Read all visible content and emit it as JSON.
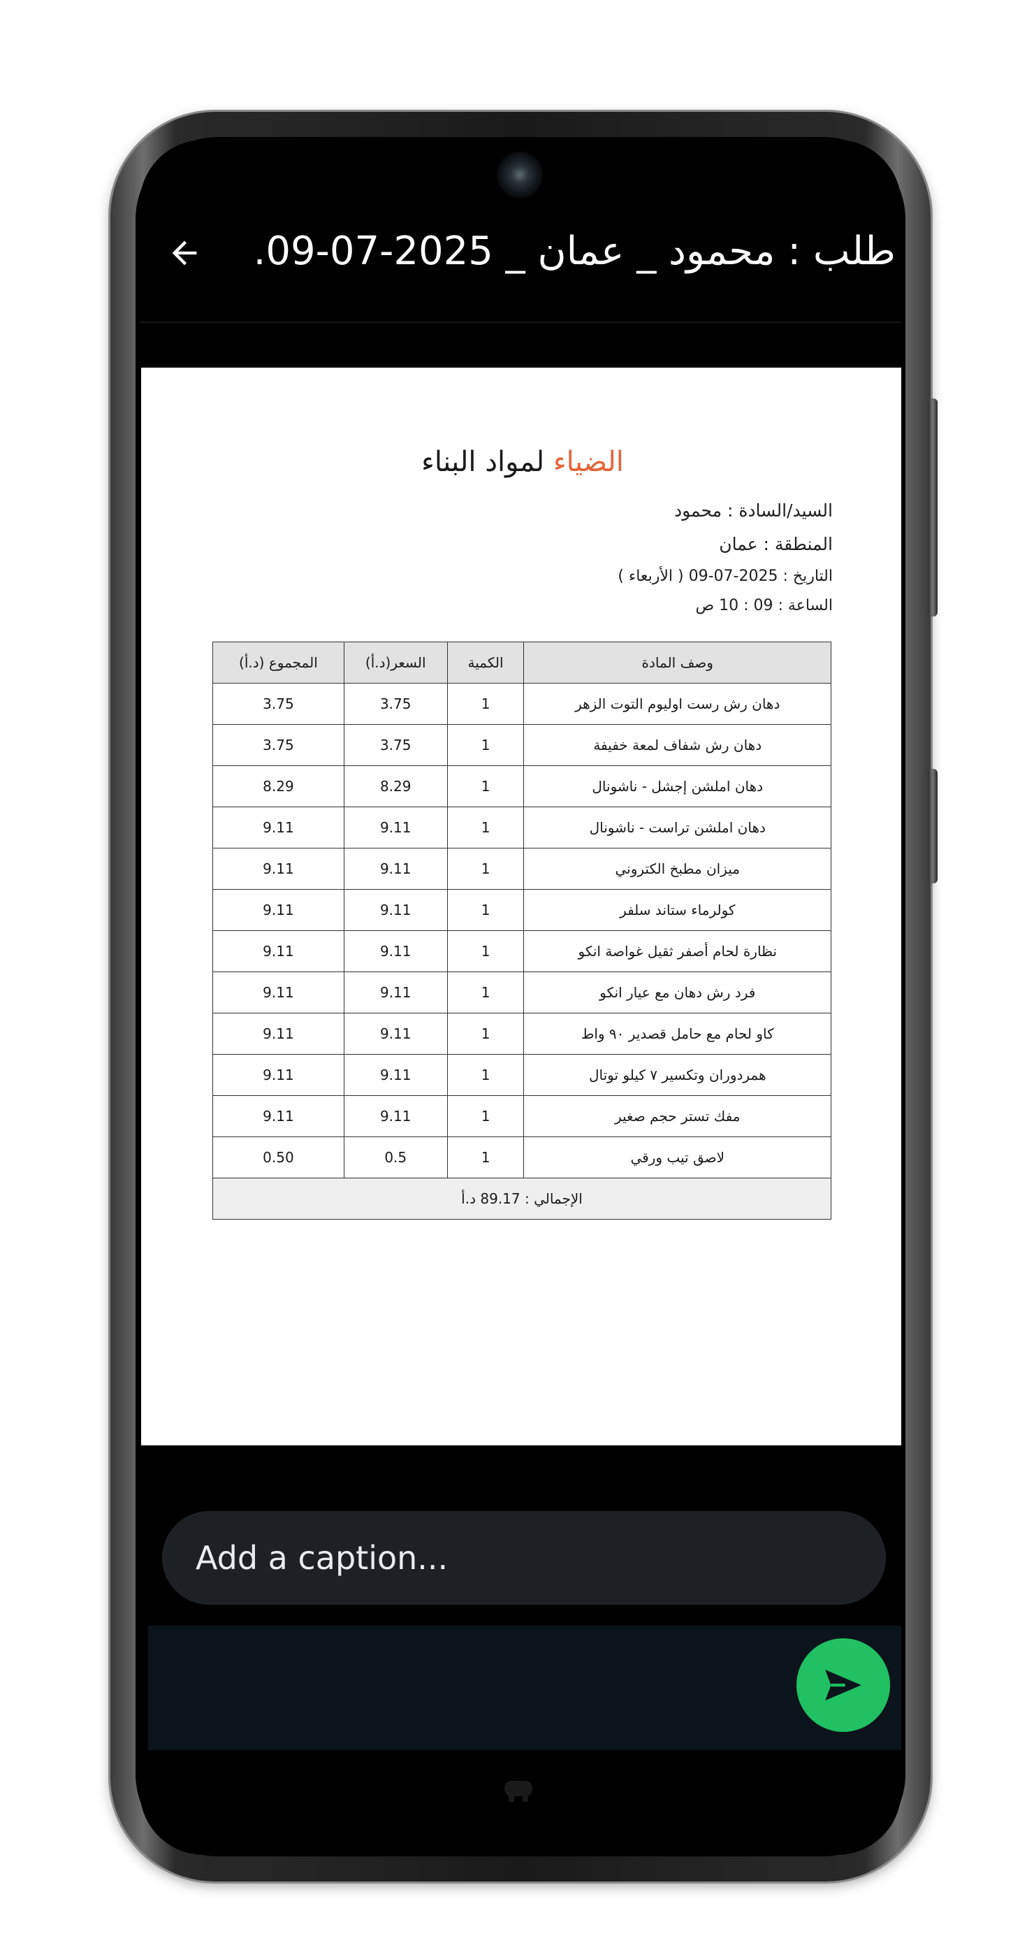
{
  "header": {
    "title": "طلب : محمود _ عمان _ 2025-07-09...."
  },
  "document": {
    "brand": "الضياء",
    "title_rest": " لمواد البناء",
    "customer": "السيد/السادة : محمود",
    "region": "المنطقة : عمان",
    "date": "التاريخ : 2025-07-09 ( الأربعاء )",
    "time": "الساعة : 09 : 10  ص",
    "table": {
      "headers": [
        "وصف المادة",
        "الكمية",
        "السعر(د.أ)",
        "المجموع (د.أ)"
      ],
      "rows": [
        [
          "دهان رش رست اوليوم التوت الزهر",
          "1",
          "3.75",
          "3.75"
        ],
        [
          "دهان رش شفاف لمعة خفيفة",
          "1",
          "3.75",
          "3.75"
        ],
        [
          "دهان املشن إجشل - ناشونال",
          "1",
          "8.29",
          "8.29"
        ],
        [
          "دهان املشن تراست - ناشونال",
          "1",
          "9.11",
          "9.11"
        ],
        [
          "ميزان مطبخ الكتروني",
          "1",
          "9.11",
          "9.11"
        ],
        [
          "كولرماء ستاند سلفر",
          "1",
          "9.11",
          "9.11"
        ],
        [
          "نظارة لحام أصفر ثقيل غواصة انكو",
          "1",
          "9.11",
          "9.11"
        ],
        [
          "فرد رش دهان مع عيار انكو",
          "1",
          "9.11",
          "9.11"
        ],
        [
          "كاو لحام مع حامل قصدير ٩٠ واط",
          "1",
          "9.11",
          "9.11"
        ],
        [
          "همردوران وتكسير ٧ كيلو توتال",
          "1",
          "9.11",
          "9.11"
        ],
        [
          "مفك تستر حجم صغير",
          "1",
          "9.11",
          "9.11"
        ],
        [
          "لاصق تيب ورقي",
          "1",
          "0.5",
          "0.50"
        ]
      ],
      "total": "الإجمالي : 89.17 د.أ"
    }
  },
  "caption": {
    "placeholder": "Add a caption..."
  },
  "icons": {
    "back": "arrow-left-icon",
    "send": "send-icon"
  },
  "colors": {
    "brand": "#e2663a",
    "send_button": "#21c063",
    "caption_bg": "#1d2125",
    "panel_bg": "#0b141a"
  }
}
